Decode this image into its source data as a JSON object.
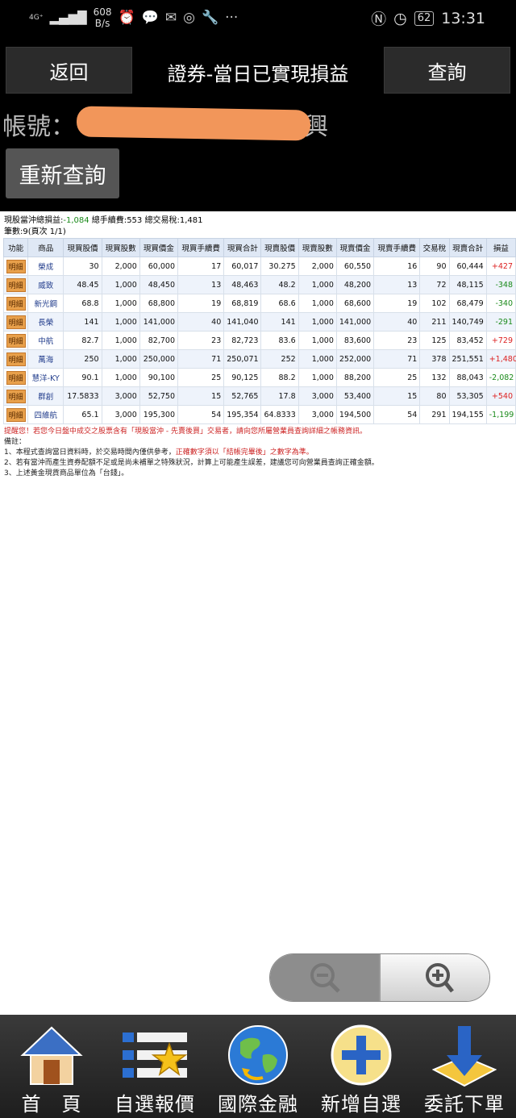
{
  "status_bar": {
    "network": "4G⁺",
    "speed_value": "608",
    "speed_unit": "B/s",
    "icons": [
      "alarm-icon",
      "chat-icon",
      "mail-icon",
      "instagram-icon",
      "wrench-icon",
      "more-icon"
    ],
    "battery": "62",
    "time": "13:31"
  },
  "header": {
    "back_label": "返回",
    "title": "證券-當日已實現損益",
    "query_label": "查詢",
    "account_label": "帳號：",
    "account_name_visible": "童俊興",
    "refresh_label": "重新查詢"
  },
  "summary": {
    "pl_label": "現股當沖總損益:",
    "pl_value": "-1,084",
    "fee_label": " 總手續費:",
    "fee_value": "553",
    "tax_label": " 總交易稅:",
    "tax_value": "1,481",
    "count_text": "筆數:9(頁次 1/1)"
  },
  "table": {
    "headers": [
      "功能",
      "商品",
      "現買股價",
      "現買股數",
      "現買價金",
      "現買手續費",
      "現買合計",
      "現賣股價",
      "現賣股數",
      "現賣價金",
      "現賣手續費",
      "交易稅",
      "現賣合計",
      "損益"
    ],
    "detail_label": "明細",
    "rows": [
      {
        "name": "榮成",
        "bp": "30",
        "bq": "2,000",
        "ba": "60,000",
        "bf": "17",
        "bt": "60,017",
        "sp": "30.275",
        "sq": "2,000",
        "sa": "60,550",
        "sf": "16",
        "tax": "90",
        "st": "60,444",
        "pl": "+427"
      },
      {
        "name": "威致",
        "bp": "48.45",
        "bq": "1,000",
        "ba": "48,450",
        "bf": "13",
        "bt": "48,463",
        "sp": "48.2",
        "sq": "1,000",
        "sa": "48,200",
        "sf": "13",
        "tax": "72",
        "st": "48,115",
        "pl": "-348"
      },
      {
        "name": "新光鋼",
        "bp": "68.8",
        "bq": "1,000",
        "ba": "68,800",
        "bf": "19",
        "bt": "68,819",
        "sp": "68.6",
        "sq": "1,000",
        "sa": "68,600",
        "sf": "19",
        "tax": "102",
        "st": "68,479",
        "pl": "-340"
      },
      {
        "name": "長榮",
        "bp": "141",
        "bq": "1,000",
        "ba": "141,000",
        "bf": "40",
        "bt": "141,040",
        "sp": "141",
        "sq": "1,000",
        "sa": "141,000",
        "sf": "40",
        "tax": "211",
        "st": "140,749",
        "pl": "-291"
      },
      {
        "name": "中航",
        "bp": "82.7",
        "bq": "1,000",
        "ba": "82,700",
        "bf": "23",
        "bt": "82,723",
        "sp": "83.6",
        "sq": "1,000",
        "sa": "83,600",
        "sf": "23",
        "tax": "125",
        "st": "83,452",
        "pl": "+729"
      },
      {
        "name": "萬海",
        "bp": "250",
        "bq": "1,000",
        "ba": "250,000",
        "bf": "71",
        "bt": "250,071",
        "sp": "252",
        "sq": "1,000",
        "sa": "252,000",
        "sf": "71",
        "tax": "378",
        "st": "251,551",
        "pl": "+1,480"
      },
      {
        "name": "慧洋-KY",
        "bp": "90.1",
        "bq": "1,000",
        "ba": "90,100",
        "bf": "25",
        "bt": "90,125",
        "sp": "88.2",
        "sq": "1,000",
        "sa": "88,200",
        "sf": "25",
        "tax": "132",
        "st": "88,043",
        "pl": "-2,082"
      },
      {
        "name": "群創",
        "bp": "17.5833",
        "bq": "3,000",
        "ba": "52,750",
        "bf": "15",
        "bt": "52,765",
        "sp": "17.8",
        "sq": "3,000",
        "sa": "53,400",
        "sf": "15",
        "tax": "80",
        "st": "53,305",
        "pl": "+540"
      },
      {
        "name": "四維航",
        "bp": "65.1",
        "bq": "3,000",
        "ba": "195,300",
        "bf": "54",
        "bt": "195,354",
        "sp": "64.8333",
        "sq": "3,000",
        "sa": "194,500",
        "sf": "54",
        "tax": "291",
        "st": "194,155",
        "pl": "-1,199"
      }
    ]
  },
  "notes": {
    "reminder": "提醒您！若您今日盤中成交之股票含有「現股當沖 - 先賣後買」交易者，請向您所屬營業員查詢詳細之帳務資訊。",
    "remarks_title": "備註：",
    "note1_a": "1、本程式查詢當日資料時，於交易時間內僅供參考，",
    "note1_b": "正確數字須以「結帳完畢後」之數字為準。",
    "note2": "2、若有當沖而產生資券配額不足或是尚未補單之特殊狀況，計算上可能產生誤差，建議您可向營業員查詢正確金額。",
    "note3": "3、上述黃金現貨商品單位為「台錢」。"
  },
  "bottom_nav": [
    {
      "label": "首　頁",
      "icon": "home-icon"
    },
    {
      "label": "自選報價",
      "icon": "watchlist-icon"
    },
    {
      "label": "國際金融",
      "icon": "globe-icon"
    },
    {
      "label": "新增自選",
      "icon": "add-icon"
    },
    {
      "label": "委託下單",
      "icon": "order-icon"
    }
  ],
  "colors": {
    "gain": "#d22222",
    "loss": "#1a8a1a",
    "header_bg": "#dfe8f5",
    "detail_button": "#e8a04b"
  }
}
